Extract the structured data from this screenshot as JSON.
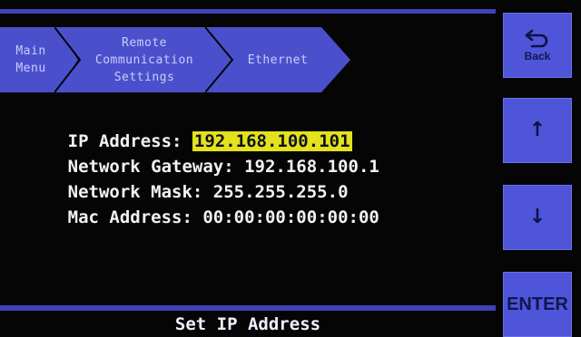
{
  "breadcrumb": {
    "items": [
      {
        "label": "Main\nMenu"
      },
      {
        "label": "Remote\nCommunication\nSettings"
      },
      {
        "label": "Ethernet"
      }
    ]
  },
  "network": {
    "ip_label": "IP Address: ",
    "ip_value": "192.168.100.101",
    "gateway_label": "Network Gateway: ",
    "gateway_value": "192.168.100.1",
    "mask_label": "Network Mask: ",
    "mask_value": "255.255.255.0",
    "mac_label": "Mac Address: ",
    "mac_value": "00:00:00:00:00:00"
  },
  "status": {
    "text": "Set IP Address"
  },
  "buttons": {
    "back_label": "Back",
    "up_glyph": "↑",
    "down_glyph": "↓",
    "enter_label": "ENTER"
  },
  "icons": {
    "back": "back-arrow-icon",
    "up": "arrow-up-icon",
    "down": "arrow-down-icon"
  },
  "colors": {
    "accent_blue": "#4f55d8",
    "bar_blue": "#3e43b8",
    "crumb_fill": "#4a50cc",
    "highlight": "#e3e21c",
    "text": "#f2f2f2",
    "background": "#050506"
  }
}
